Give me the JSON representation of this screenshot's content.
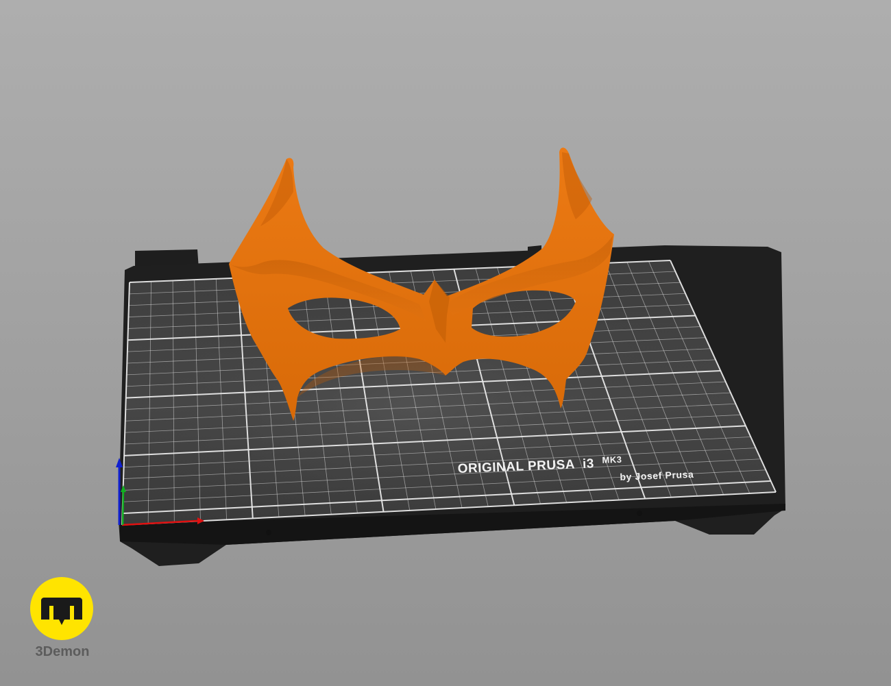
{
  "viewport": {
    "background_top": "#aeaeae",
    "background_bottom": "#929292"
  },
  "bed": {
    "label_line1": "ORIGINAL PRUSA",
    "label_model": "i3",
    "label_version": "MK3",
    "label_line2": "by Josef Prusa",
    "plate_color": "#3a3a3a",
    "frame_color": "#1f1f1f",
    "grid_color": "#e8e8e8"
  },
  "model": {
    "color": "#e87510",
    "shade_color": "#b85500"
  },
  "axes": {
    "x_color": "#e01010",
    "y_color": "#10b020",
    "z_color": "#1020d0"
  },
  "watermark": {
    "brand": "3Demon",
    "accent": "#ffe400"
  }
}
